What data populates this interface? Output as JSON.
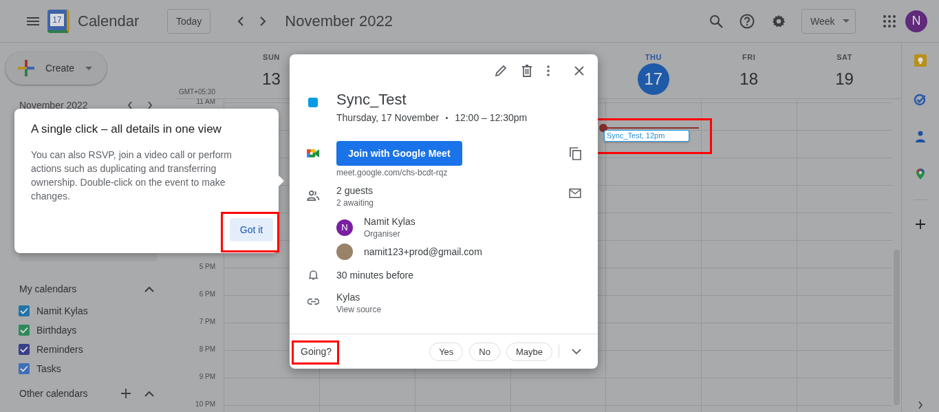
{
  "header": {
    "app_name": "Calendar",
    "logo_day": "17",
    "today_button": "Today",
    "period": "November 2022",
    "view_selector": "Week",
    "avatar_letter": "N"
  },
  "sidebar": {
    "create_button": "Create",
    "mini_calendar_title": "November 2022",
    "my_calendars": {
      "title": "My calendars",
      "items": [
        {
          "label": "Namit Kylas",
          "checked": true,
          "color": "#1f74a8"
        },
        {
          "label": "Birthdays",
          "checked": true,
          "color": "#2e8a5a"
        },
        {
          "label": "Reminders",
          "checked": true,
          "color": "#3a3f8a"
        },
        {
          "label": "Tasks",
          "checked": true,
          "color": "#3e6fb8"
        }
      ]
    },
    "other_calendars": {
      "title": "Other calendars"
    }
  },
  "week": {
    "timezone": "GMT+05:30",
    "days": [
      {
        "weekday": "SUN",
        "date": "13",
        "today": false
      },
      {
        "weekday": "THU",
        "date": "17",
        "today": true
      },
      {
        "weekday": "FRI",
        "date": "18",
        "today": false
      },
      {
        "weekday": "SAT",
        "date": "19",
        "today": false
      }
    ],
    "time_labels": {
      "top": "11 AM",
      "lower": [
        "5 PM",
        "6 PM",
        "7 PM",
        "8 PM",
        "9 PM",
        "10 PM"
      ]
    },
    "event_chip": {
      "title": "Sync_Test",
      "time": ", 12pm"
    }
  },
  "tooltip": {
    "title": "A single click – all details in one view",
    "body": "You can also RSVP, join a video call or perform actions such as duplicating and transferring ownership. Double-click on the event to make changes.",
    "button": "Got it"
  },
  "event_popup": {
    "title": "Sync_Test",
    "date": "Thursday, 17 November",
    "time": "12:00 – 12:30pm",
    "meet_button": "Join with Google Meet",
    "meet_link": "meet.google.com/chs-bcdt-rqz",
    "guests_count": "2 guests",
    "guests_status": "2 awaiting",
    "guests": [
      {
        "kind": "letter",
        "avatar": "N",
        "name": "Namit Kylas",
        "role": "Organiser"
      },
      {
        "kind": "photo",
        "name": "namit123+prod@gmail.com"
      }
    ],
    "reminder": "30 minutes before",
    "calendar": "Kylas",
    "source_link": "View source",
    "rsvp": {
      "label": "Going?",
      "options": [
        {
          "label": "Yes",
          "selected": false
        },
        {
          "label": "No",
          "selected": false
        },
        {
          "label": "Maybe",
          "selected": false
        }
      ]
    }
  }
}
